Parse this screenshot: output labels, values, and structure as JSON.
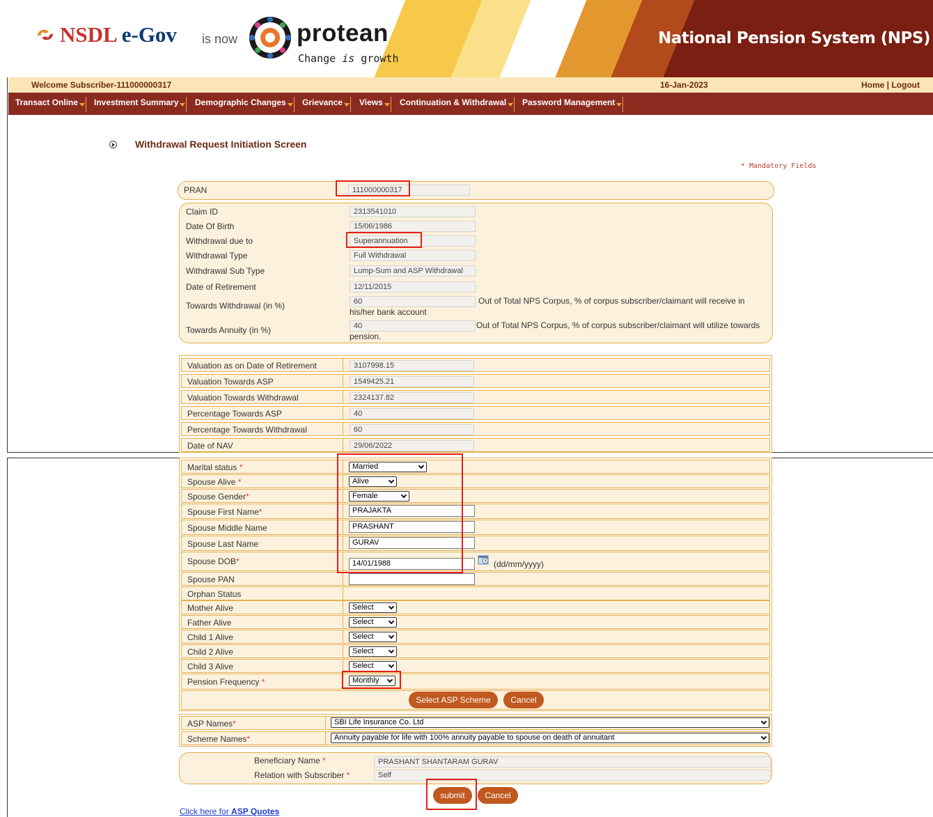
{
  "header": {
    "brand_left": "NSDL",
    "brand_egov": "e-Gov",
    "brand_isnow": "is now",
    "brand_protean": "protean",
    "tagline_start": "Change ",
    "tagline_is": "is",
    "tagline_end": " growth",
    "system_title": "National Pension System (NPS)",
    "welcome": "Welcome Subscriber-111000000317",
    "date": "16-Jan-2023",
    "home": "Home",
    "separator": " | ",
    "logout": "Logout"
  },
  "menu": [
    "Transact Online",
    "Investment Summary",
    "Demographic Changes",
    "Grievance",
    "Views",
    "Continuation & Withdrawal",
    "Password Management"
  ],
  "page": {
    "title": "Withdrawal Request Initiation Screen",
    "mandatory_note": "* Mandatory Fields"
  },
  "pran": {
    "label": "PRAN",
    "value": "111000000317"
  },
  "claim": {
    "claim_id_label": "Claim ID",
    "claim_id": "2313541010",
    "dob_label": "Date Of Birth",
    "dob": "15/06/1986",
    "due_to_label": "Withdrawal due to",
    "due_to": "Superannuation",
    "type_label": "Withdrawal Type",
    "type": "Full Withdrawal",
    "subtype_label": "Withdrawal Sub Type",
    "subtype": "Lump-Sum and ASP Withdrawal",
    "retirement_label": "Date of Retirement",
    "retirement": "12/11/2015",
    "withdrawal_pct_label": "Towards Withdrawal (in %)",
    "withdrawal_pct": "60",
    "withdrawal_pct_desc_1": "Out of Total NPS Corpus, % of corpus subscriber/claimant will receive in",
    "withdrawal_pct_desc_2": "his/her bank account",
    "annuity_pct_label": "Towards Annuity (in %)",
    "annuity_pct": "40",
    "annuity_pct_desc_1": "Out of Total NPS Corpus, % of corpus subscriber/claimant will utilize towards",
    "annuity_pct_desc_2": "pension."
  },
  "valuation": [
    {
      "label": "Valuation as on Date of Retirement",
      "value": "3107998.15"
    },
    {
      "label": "Valuation Towards ASP",
      "value": "1549425.21"
    },
    {
      "label": "Valuation Towards Withdrawal",
      "value": "2324137.82"
    },
    {
      "label": "Percentage Towards ASP",
      "value": "40"
    },
    {
      "label": "Percentage Towards Withdrawal",
      "value": "60"
    },
    {
      "label": "Date of NAV",
      "value": "29/06/2022"
    }
  ],
  "family": {
    "marital_label": "Marital status ",
    "marital": "Married",
    "spouse_alive_label": "Spouse Alive ",
    "spouse_alive": "Alive",
    "spouse_gender_label": "Spouse Gender",
    "spouse_gender": "Female",
    "spouse_first_label": "Spouse First Name",
    "spouse_first": "PRAJAKTA",
    "spouse_middle_label": "Spouse Middle Name",
    "spouse_middle": "PRASHANT",
    "spouse_last_label": "Spouse Last Name",
    "spouse_last": "GURAV",
    "spouse_dob_label": "Spouse DOB",
    "spouse_dob": "14/01/1988",
    "dob_format": "(dd/mm/yyyy)",
    "spouse_pan_label": "Spouse PAN",
    "spouse_pan": "",
    "orphan_label": "Orphan Status",
    "mother_label": "Mother Alive",
    "mother": "Select",
    "father_label": "Father Alive",
    "father": "Select",
    "child1_label": "Child 1 Alive",
    "child1": "Select",
    "child2_label": "Child 2 Alive",
    "child2": "Select",
    "child3_label": "Child 3 Alive",
    "child3": "Select",
    "frequency_label": "Pension Frequency ",
    "frequency": "Monthly",
    "select_asp_button": "Select ASP Scheme",
    "cancel_button": "Cancel"
  },
  "asp": {
    "names_label": "ASP Names",
    "names": "SBI Life Insurance Co. Ltd",
    "scheme_label": "Scheme Names",
    "scheme": "Annuity payable for life with 100% annuity payable to spouse on death of annuitant"
  },
  "beneficiary": {
    "name_label": "Beneficiary Name ",
    "name": "PRASHANT SHANTARAM GURAV",
    "relation_label": "Relation with Subscriber ",
    "relation": "Self"
  },
  "footer": {
    "submit_button": "submit",
    "cancel_button": "Cancel",
    "link_prefix": "Click here for ",
    "link_bold": "ASP Quotes"
  },
  "colors": {
    "banner_dark": "#7a1f12",
    "menu_bg": "#8b2a1f",
    "welcome_bg": "#fbe5b6",
    "panel_bg": "#fcf1dd",
    "panel_border": "#e5ae4d",
    "button": "#c0581f",
    "required_star": "#e23b2e",
    "highlight_box": "#e0201d"
  }
}
